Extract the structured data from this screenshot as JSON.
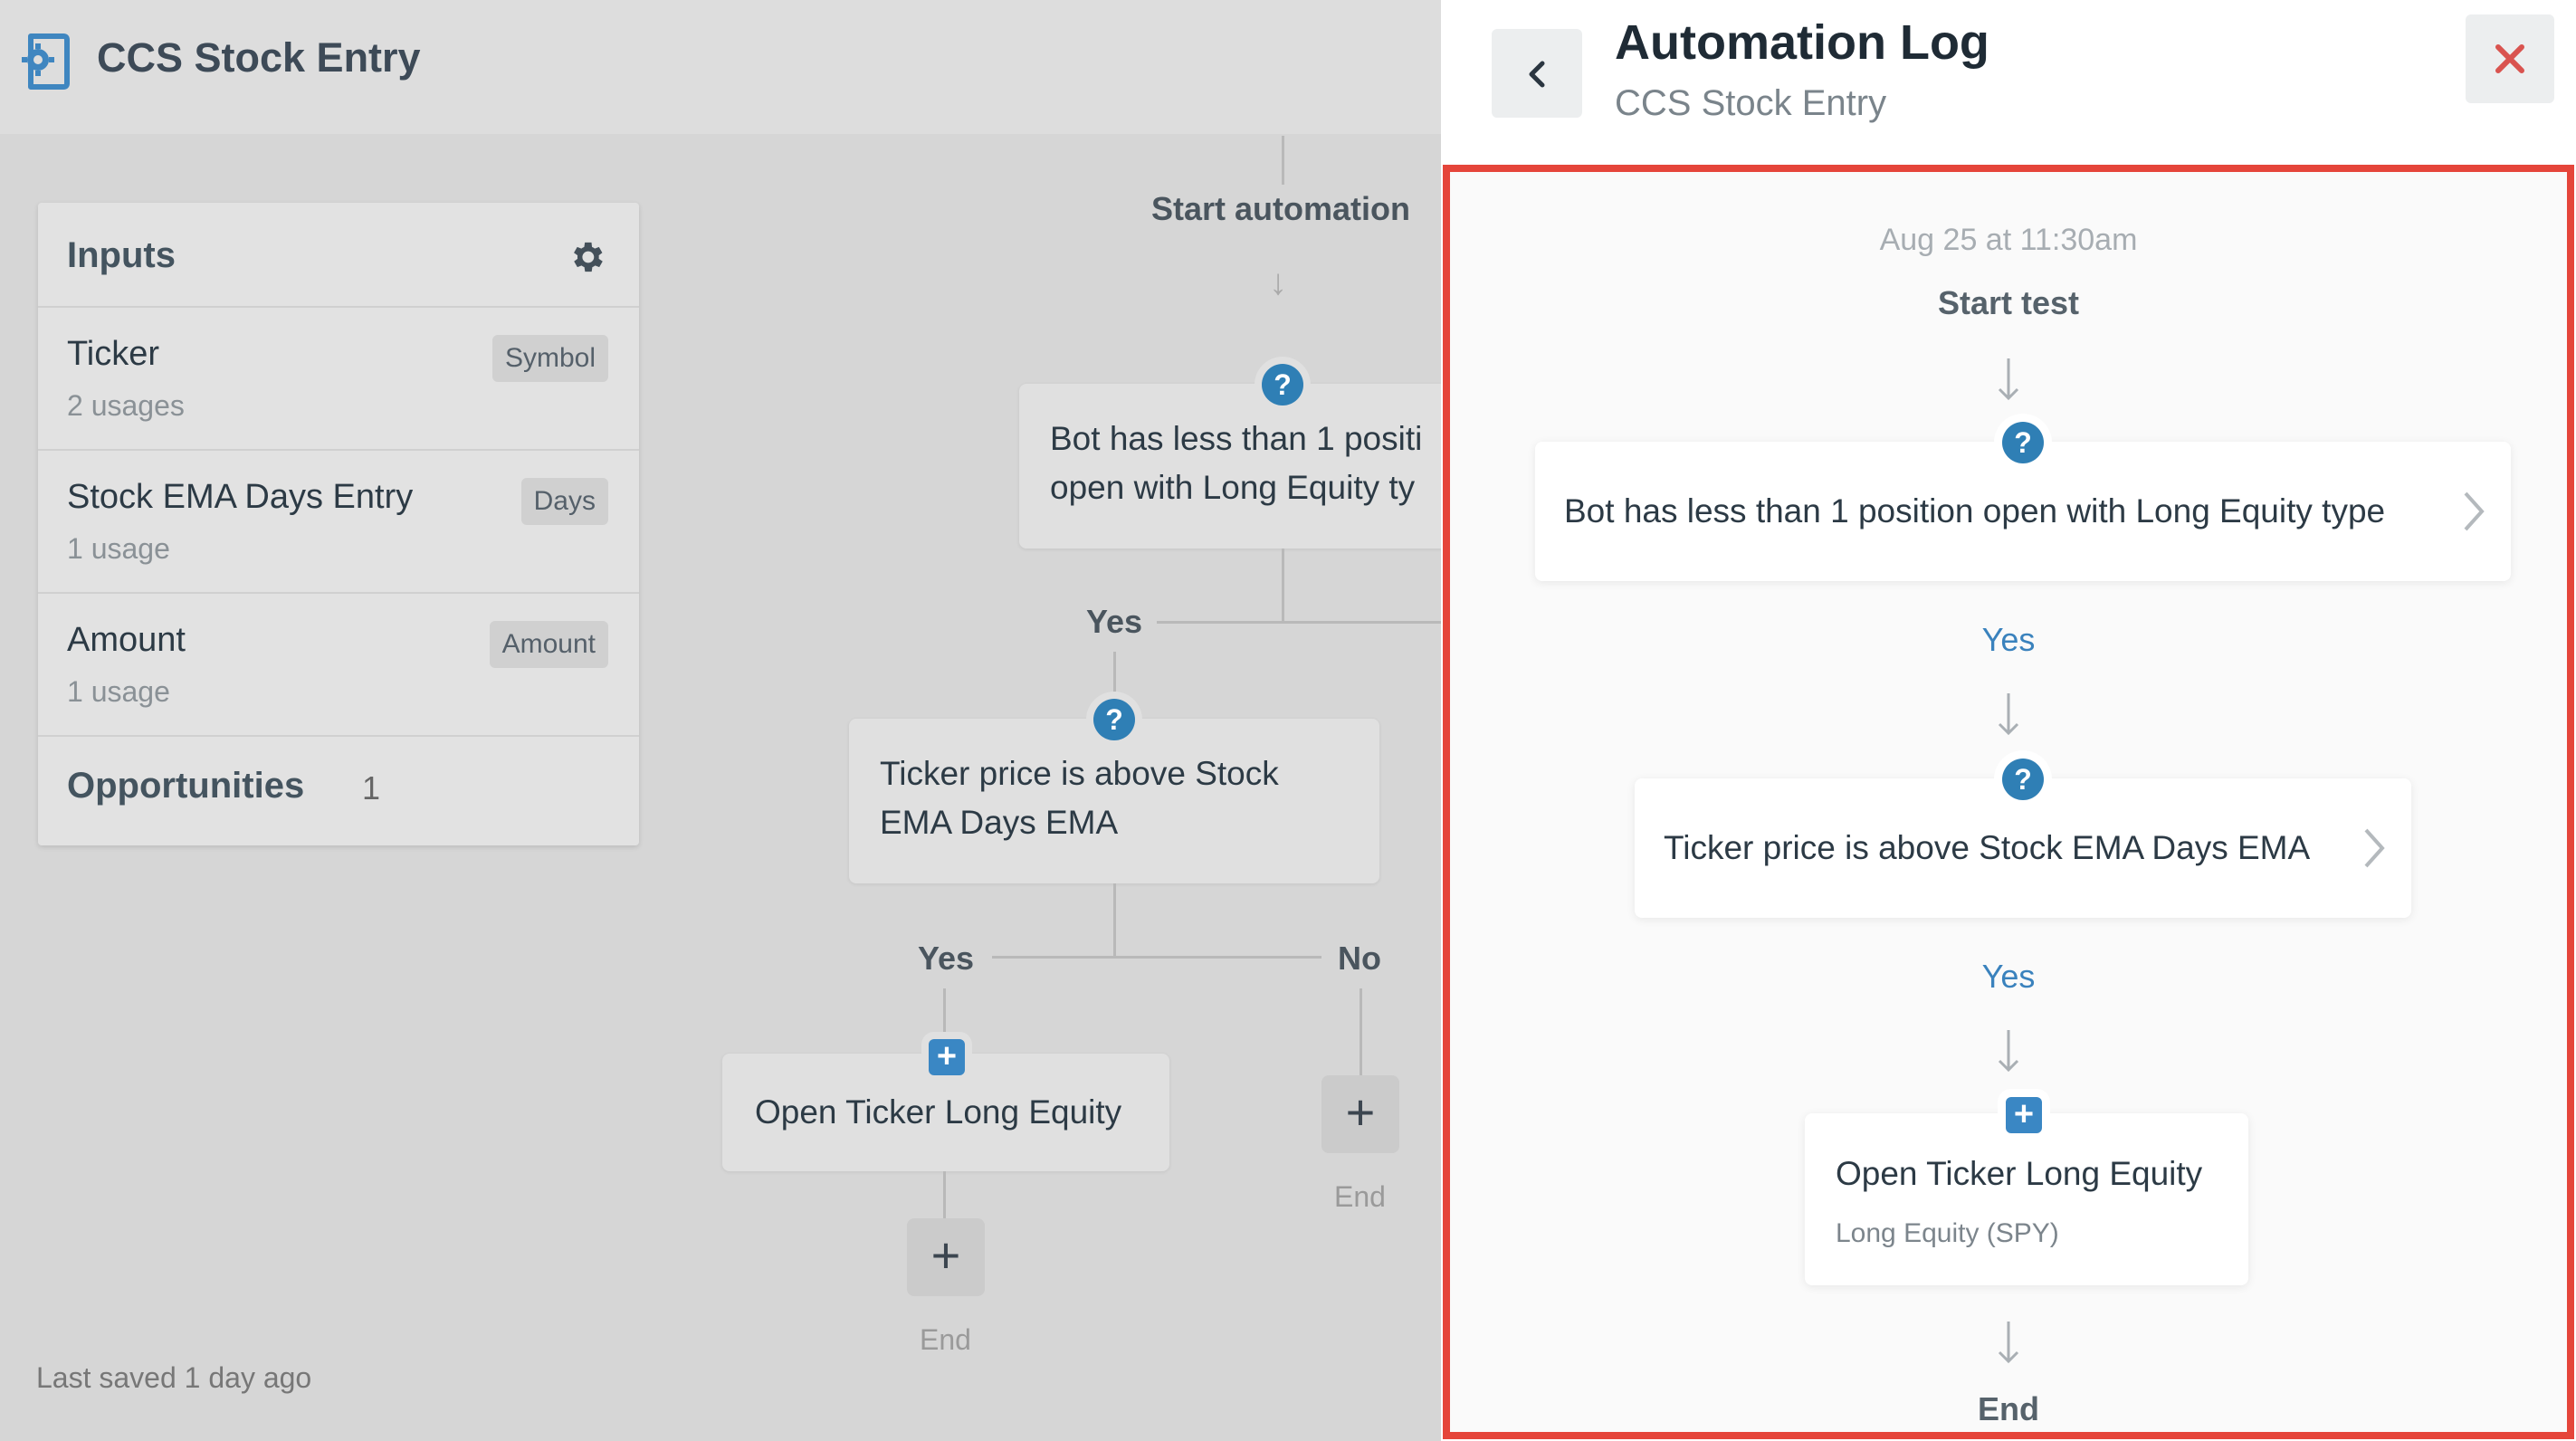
{
  "app": {
    "title": "CCS Stock Entry",
    "last_saved": "Last saved 1 day ago"
  },
  "inputs": {
    "title": "Inputs",
    "items": [
      {
        "name": "Ticker",
        "usage": "2 usages",
        "badge": "Symbol"
      },
      {
        "name": "Stock EMA Days Entry",
        "usage": "1 usage",
        "badge": "Days"
      },
      {
        "name": "Amount",
        "usage": "1 usage",
        "badge": "Amount"
      }
    ],
    "opportunities_label": "Opportunities",
    "opportunities_count": "1"
  },
  "flow": {
    "start_label": "Start automation",
    "condition1_line1": "Bot has less than 1 positi",
    "condition1_line2": "open with Long Equity ty",
    "yes1": "Yes",
    "condition2_line1": "Ticker price is above Stock",
    "condition2_line2": "EMA Days EMA",
    "yes2": "Yes",
    "no2": "No",
    "action": "Open Ticker Long Equity",
    "end_a": "End",
    "end_b": "End"
  },
  "log": {
    "title": "Automation Log",
    "subtitle": "CCS Stock Entry",
    "timestamp": "Aug 25 at 11:30am",
    "start": "Start test",
    "condition1": "Bot has less than 1 position open with Long Equity type",
    "yes1": "Yes",
    "condition2": "Ticker price is above Stock EMA Days EMA",
    "yes2": "Yes",
    "action": "Open Ticker Long Equity",
    "action_detail": "Long Equity (SPY)",
    "end": "End"
  },
  "colors": {
    "accent": "#2f7fb5",
    "highlight_border": "#e5453a",
    "close_icon": "#d9534f"
  },
  "icons": [
    "app-logo-icon",
    "gear-icon",
    "question-icon",
    "plus-icon",
    "back-chevron-icon",
    "close-icon",
    "chevron-right-icon",
    "arrow-down-icon"
  ]
}
